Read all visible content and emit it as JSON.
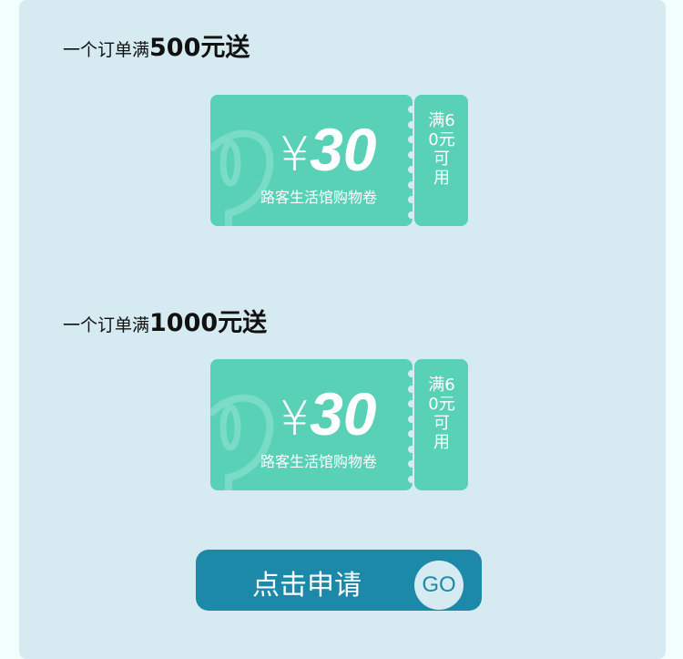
{
  "offers": [
    {
      "prefix": "一个订单满",
      "threshold": "500元送",
      "coupon": {
        "currency": "¥",
        "amount": "30",
        "name": "路客生活馆购物卷",
        "condition": "满60元可用"
      }
    },
    {
      "prefix": "一个订单满",
      "threshold": "1000元送",
      "coupon": {
        "currency": "¥",
        "amount": "30",
        "name": "路客生活馆购物卷",
        "condition": "满60元可用"
      }
    }
  ],
  "button": {
    "label": "点击申请",
    "go": "GO"
  },
  "colors": {
    "panel": "#d6eaf1",
    "coupon": "#58d1b6",
    "button": "#1d89a9"
  }
}
